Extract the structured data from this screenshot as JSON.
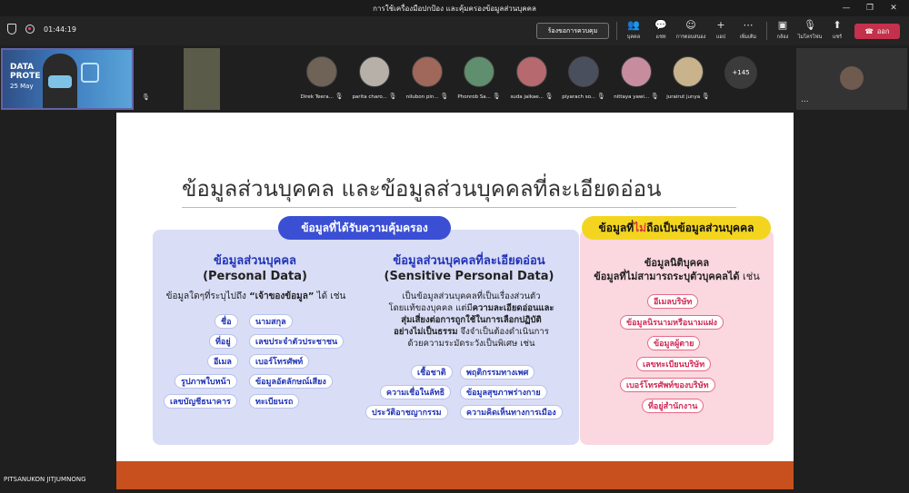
{
  "window": {
    "title": "การใช้เครื่องมือปกป้อง และคุ้มครองข้อมูลส่วนบุคคล",
    "minimize": "—",
    "restore": "❐",
    "close": "✕"
  },
  "toolbar": {
    "timer": "01:44:19",
    "request_control": "ร้องขอการควบคุม",
    "items": [
      {
        "label": "บุคคล",
        "icon": "people-icon",
        "glyph": "👥"
      },
      {
        "label": "แชท",
        "icon": "chat-icon",
        "glyph": "💬"
      },
      {
        "label": "การตอบสนอง",
        "icon": "reactions-icon",
        "glyph": "☺"
      },
      {
        "label": "แอป",
        "icon": "apps-icon",
        "glyph": "+"
      },
      {
        "label": "เพิ่มเติม",
        "icon": "more-icon",
        "glyph": "⋯"
      },
      {
        "label": "กล้อง",
        "icon": "camera-off-icon",
        "glyph": "▣"
      },
      {
        "label": "ไมโครโฟน",
        "icon": "mic-off-icon",
        "glyph": "🎙"
      },
      {
        "label": "แชร์",
        "icon": "share-icon",
        "glyph": "⬆"
      }
    ],
    "leave": "ออก",
    "leave_color": "#c4314b"
  },
  "presenter": {
    "title_line1": "DATA",
    "title_line2": "PROTE",
    "date": "25 May"
  },
  "participants": [
    {
      "name": "Direk Teera..."
    },
    {
      "name": "parita charo..."
    },
    {
      "name": "nilubon pin..."
    },
    {
      "name": "Phonrob Sa..."
    },
    {
      "name": "suda jaikae..."
    },
    {
      "name": "piyarach so..."
    },
    {
      "name": "nittaya yawi..."
    },
    {
      "name": "jurairut junya"
    }
  ],
  "more_participants": "+145",
  "self_more": "...",
  "shared_by": "PITSANUKON JITJUMNONG",
  "slide": {
    "title": "ข้อมูลส่วนบุคคล และข้อมูลส่วนบุคคลที่ละเอียดอ่อน",
    "protected_header": "ข้อมูลที่ได้รับความคุ้มครอง",
    "not_personal_header_pre": "ข้อมูลที่",
    "not_personal_header_neg": "ไม่",
    "not_personal_header_post": "ถือเป็นข้อมูลส่วนบุคคล",
    "personal": {
      "title_th": "ข้อมูลส่วนบุคคล",
      "title_en": "(Personal Data)",
      "desc_pre": "ข้อมูลใดๆที่ระบุไปถึง ",
      "desc_bold": "“เจ้าของข้อมูล”",
      "desc_post": " ได้ เช่น",
      "tags": [
        "ชื่อ",
        "นามสกุล",
        "ที่อยู่",
        "เลขประจำตัวประชาชน",
        "อีเมล",
        "เบอร์โทรศัพท์",
        "รูปภาพใบหน้า",
        "ข้อมูลอัตลักษณ์เสียง",
        "เลขบัญชีธนาคาร",
        "ทะเบียนรถ"
      ]
    },
    "sensitive": {
      "title_th": "ข้อมูลส่วนบุคคลที่ละเอียดอ่อน",
      "title_en": "(Sensitive Personal Data)",
      "line1": "เป็นข้อมูลส่วนบุคคลที่เป็นเรื่องส่วนตัว",
      "line2_pre": "โดยแท้ของบุคคล แต่มี",
      "line2_bold": "ความละเอียดอ่อนและ",
      "line3_bold": "สุ่มเสี่ยงต่อการถูกใช้ในการเลือกปฏิบัติ",
      "line4_bold": "อย่างไม่เป็นธรรม",
      "line4_post": " จึงจำเป็นต้องดำเนินการ",
      "line5": "ด้วยความระมัดระวังเป็นพิเศษ เช่น",
      "tags": [
        "เชื้อชาติ",
        "พฤติกรรมทางเพศ",
        "ความเชื่อในลัทธิ",
        "ข้อมูลสุขภาพร่างกาย",
        "ประวัติอาชญากรรม",
        "ความคิดเห็นทางการเมือง"
      ]
    },
    "not_personal": {
      "title": "ข้อมูลนิติบุคคล",
      "sub_bold": "ข้อมูลที่ไม่สามารถระบุตัวบุคคลได้",
      "sub_post": " เช่น",
      "tags": [
        "อีเมลบริษัท",
        "ข้อมูลนิรนามหรือนามแฝง",
        "ข้อมูลผู้ตาย",
        "เลขทะเบียนบริษัท",
        "เบอร์โทรศัพท์ของบริษัท",
        "ที่อยู่สำนักงาน"
      ]
    },
    "colors": {
      "blue_header": "#3a4fd3",
      "yellow_header": "#f3d520",
      "blue_panel": "#d9ddf6",
      "pink_panel": "#fbd7df",
      "footer_bar": "#c8501e"
    }
  }
}
